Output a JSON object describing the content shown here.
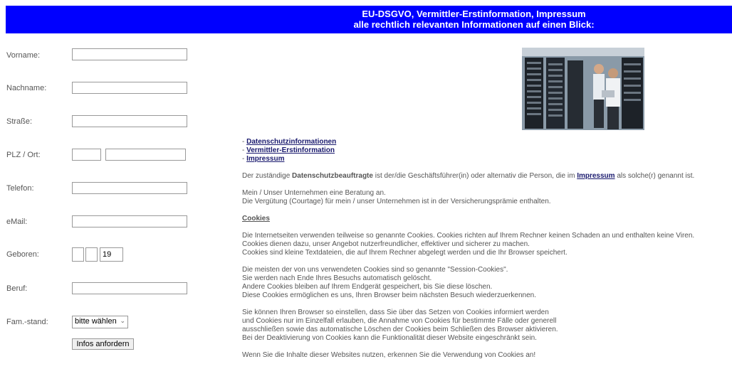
{
  "header": {
    "line1": "EU-DSGVO, Vermittler-Erstinformation, Impressum",
    "line2": "alle rechtlich relevanten Informationen auf einen Blick:"
  },
  "form": {
    "vorname_label": "Vorname:",
    "nachname_label": "Nachname:",
    "strasse_label": "Straße:",
    "plz_label": "PLZ / Ort:",
    "telefon_label": "Telefon:",
    "email_label": "eMail:",
    "geboren_label": "Geboren:",
    "geboren_year_prefix": "19",
    "beruf_label": "Beruf:",
    "famstand_label": "Fam.-stand:",
    "famstand_selected": "bitte wählen",
    "submit_label": "Infos anfordern"
  },
  "content": {
    "link_datenschutz": "Datenschutzinformationen",
    "link_vermittler": "Vermittler-Erstinformation",
    "link_impressum": "Impressum",
    "dsb_pre": "Der zuständige ",
    "dsb_bold": "Datenschutzbeauftragte",
    "dsb_mid": " ist der/die Geschäftsführer(in) oder alternativ die Person, die im ",
    "dsb_link": "Impressum",
    "dsb_post": " als solche(r) genannt ist.",
    "beratung_1": "Mein / Unser Unternehmen eine Beratung an.",
    "beratung_2": "Die Vergütung (Courtage) für mein / unser Unternehmen ist in der Versicherungsprämie enthalten.",
    "cookies_heading": "Cookies",
    "p1_1": "Die Internetseiten verwenden teilweise so genannte Cookies. Cookies richten auf Ihrem Rechner keinen Schaden an und enthalten keine Viren.",
    "p1_2": "Cookies dienen dazu, unser Angebot nutzerfreundlicher, effektiver und sicherer zu machen.",
    "p1_3": "Cookies sind kleine Textdateien, die auf Ihrem Rechner abgelegt werden und die Ihr Browser speichert.",
    "p2_1": "Die meisten der von uns verwendeten Cookies sind so genannte \"Session-Cookies\".",
    "p2_2": "Sie werden nach Ende Ihres Besuchs automatisch gelöscht.",
    "p2_3": "Andere Cookies bleiben auf Ihrem Endgerät gespeichert, bis Sie diese löschen.",
    "p2_4": "Diese Cookies ermöglichen es uns, Ihren Browser beim nächsten Besuch wiederzuerkennen.",
    "p3_1": "Sie können Ihren Browser so einstellen, dass Sie über das Setzen von Cookies informiert werden",
    "p3_2": "und Cookies nur im Einzelfall erlauben, die Annahme von Cookies für bestimmte Fälle oder generell",
    "p3_3": "ausschließen sowie das automatische Löschen der Cookies beim Schließen des Browser aktivieren.",
    "p3_4": "Bei der Deaktivierung von Cookies kann die Funktionalität dieser Website eingeschränkt sein.",
    "p4_1": "Wenn Sie die Inhalte dieser Websites nutzen, erkennen Sie die Verwendung von Cookies an!"
  }
}
